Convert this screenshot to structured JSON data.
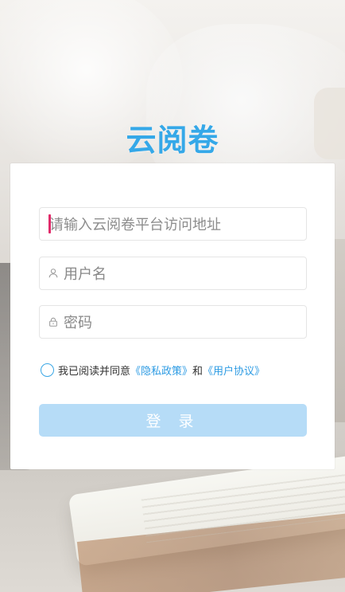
{
  "header": {
    "title": "云阅卷"
  },
  "form": {
    "platform_placeholder": "请输入云阅卷平台访问地址",
    "username_placeholder": "用户名",
    "password_placeholder": "密码",
    "agreement": {
      "prefix": "我已阅读并同意",
      "privacy_link": "《隐私政策》",
      "join": "和",
      "user_link": "《用户协议》"
    },
    "login_label": "登 录"
  },
  "colors": {
    "accent": "#35a8e8",
    "link": "#2d9be3",
    "button": "#b6dcf7",
    "caret": "#e12b6a"
  },
  "icons": {
    "user": "user-icon",
    "lock": "lock-icon",
    "agreement": "radio-icon"
  }
}
